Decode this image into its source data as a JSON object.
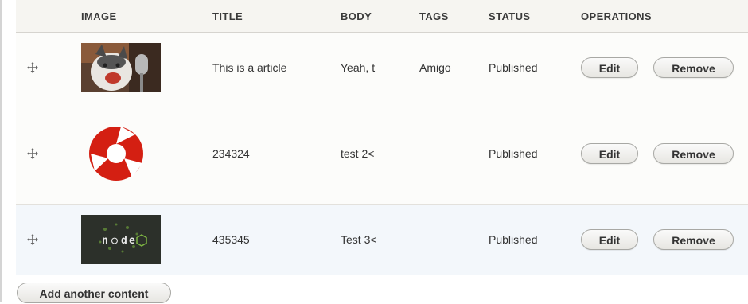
{
  "headers": {
    "image": "IMAGE",
    "title": "TITLE",
    "body": "BODY",
    "tags": "TAGS",
    "status": "STATUS",
    "operations": "OPERATIONS"
  },
  "rows": [
    {
      "image_icon": "husky-photo-icon",
      "title": "This is a article",
      "body": "Yeah, t",
      "tags": "Amigo",
      "status": "Published",
      "edit_label": "Edit",
      "remove_label": "Remove"
    },
    {
      "image_icon": "red-tri-swirl-logo-icon",
      "title": "234324",
      "body": "test 2<",
      "tags": "",
      "status": "Published",
      "edit_label": "Edit",
      "remove_label": "Remove"
    },
    {
      "image_icon": "node-logo-icon",
      "title": "435345",
      "body": "Test 3<",
      "tags": "",
      "status": "Published",
      "edit_label": "Edit",
      "remove_label": "Remove"
    }
  ],
  "add_button_label": "Add another content",
  "colors": {
    "header_bg": "#f6f5f1",
    "row_bg": "#fcfcfa",
    "row_highlight_bg": "#f3f7fb",
    "logo_red": "#d41f12"
  }
}
